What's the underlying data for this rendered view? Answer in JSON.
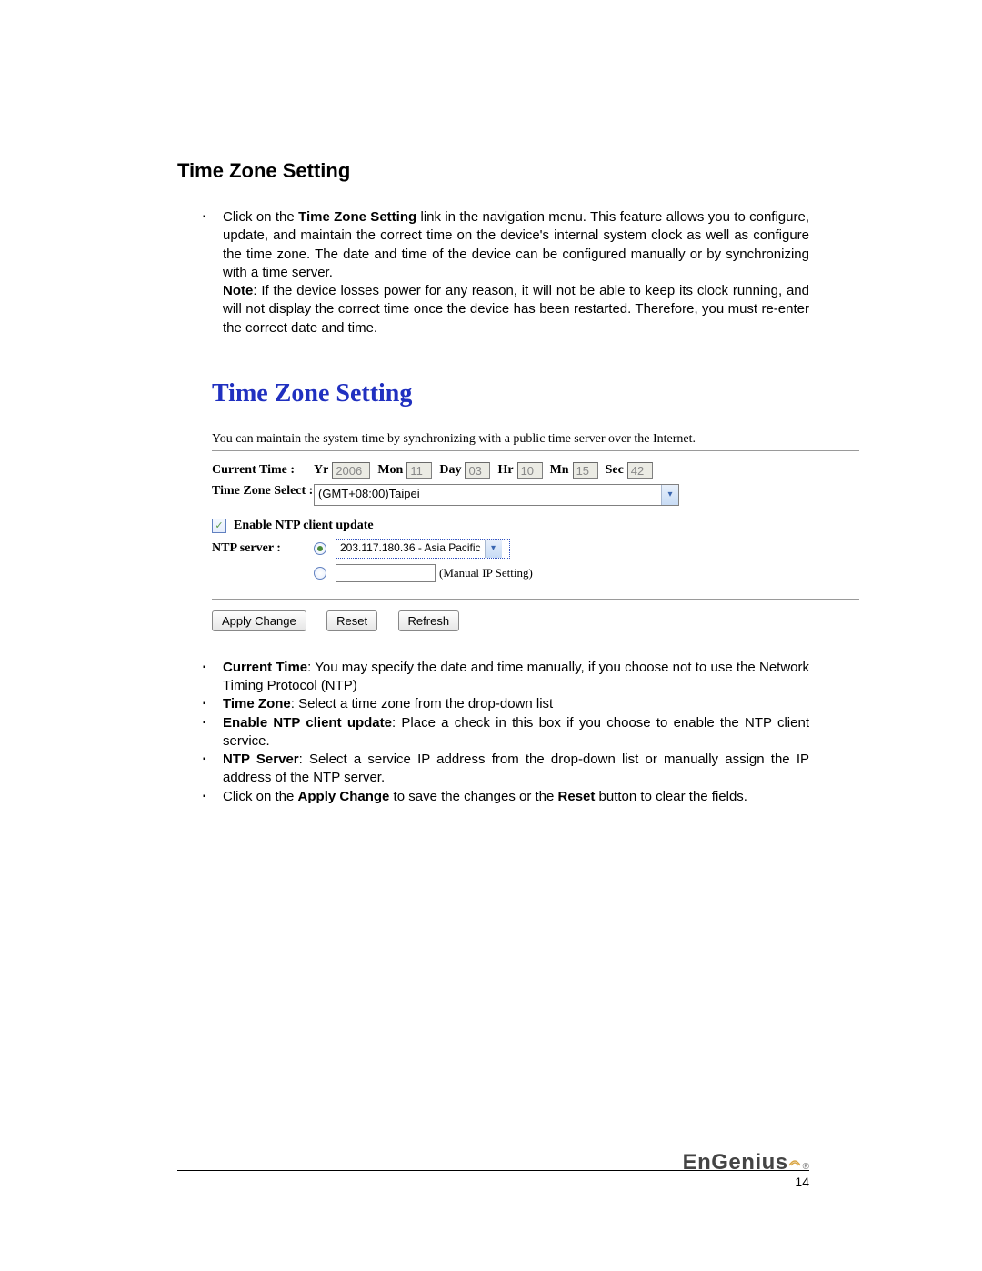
{
  "section_title": "Time Zone Setting",
  "intro": {
    "bullet_lead": "Click on the ",
    "bullet_bold_1": "Time Zone Setting",
    "bullet_tail": " link in the navigation menu. This feature allows you to configure, update, and maintain the correct time on the device's internal system clock as well as configure the time zone.  The date and time of the device can be configured manually or by synchronizing with a time server.",
    "note_label": "Note",
    "note_text": ": If the device losses power for any reason, it will not be able to keep its clock running, and will not display the correct time once the device has been restarted. Therefore, you must re-enter the correct date and time."
  },
  "panel": {
    "title": "Time Zone Setting",
    "caption": "You can maintain the system time by synchronizing with a public time server over the Internet.",
    "current_time_label": "Current Time :",
    "yr_label": "Yr",
    "yr_val": "2006",
    "mon_label": "Mon",
    "mon_val": "11",
    "day_label": "Day",
    "day_val": "03",
    "hr_label": "Hr",
    "hr_val": "10",
    "mn_label": "Mn",
    "mn_val": "15",
    "sec_label": "Sec",
    "sec_val": "42",
    "tz_label": "Time Zone Select :",
    "tz_value": "(GMT+08:00)Taipei",
    "enable_ntp_label": "Enable NTP client update",
    "ntp_server_label": "NTP server :",
    "ntp_server_value": "203.117.180.36 - Asia Pacific",
    "manual_ip_label": "(Manual IP Setting)",
    "btn_apply": "Apply Change",
    "btn_reset": "Reset",
    "btn_refresh": "Refresh"
  },
  "desc": {
    "d1_b": "Current Time",
    "d1_t": ": You may specify the date and time manually, if you choose not to use the Network Timing Protocol (NTP)",
    "d2_b": "Time Zone",
    "d2_t": ": Select a time zone from the drop-down list",
    "d3_b": "Enable NTP client update",
    "d3_t": ": Place a check in this box if you choose to enable the NTP client service.",
    "d4_b": "NTP Server",
    "d4_t": ": Select a service IP address from the drop-down list or manually assign the IP address of the NTP server.",
    "d5_lead": "Click on the ",
    "d5_b1": "Apply Change",
    "d5_mid": " to save the changes or the ",
    "d5_b2": "Reset",
    "d5_tail": " button to clear the fields."
  },
  "footer": {
    "logo": "EnGenius",
    "page": "14"
  }
}
